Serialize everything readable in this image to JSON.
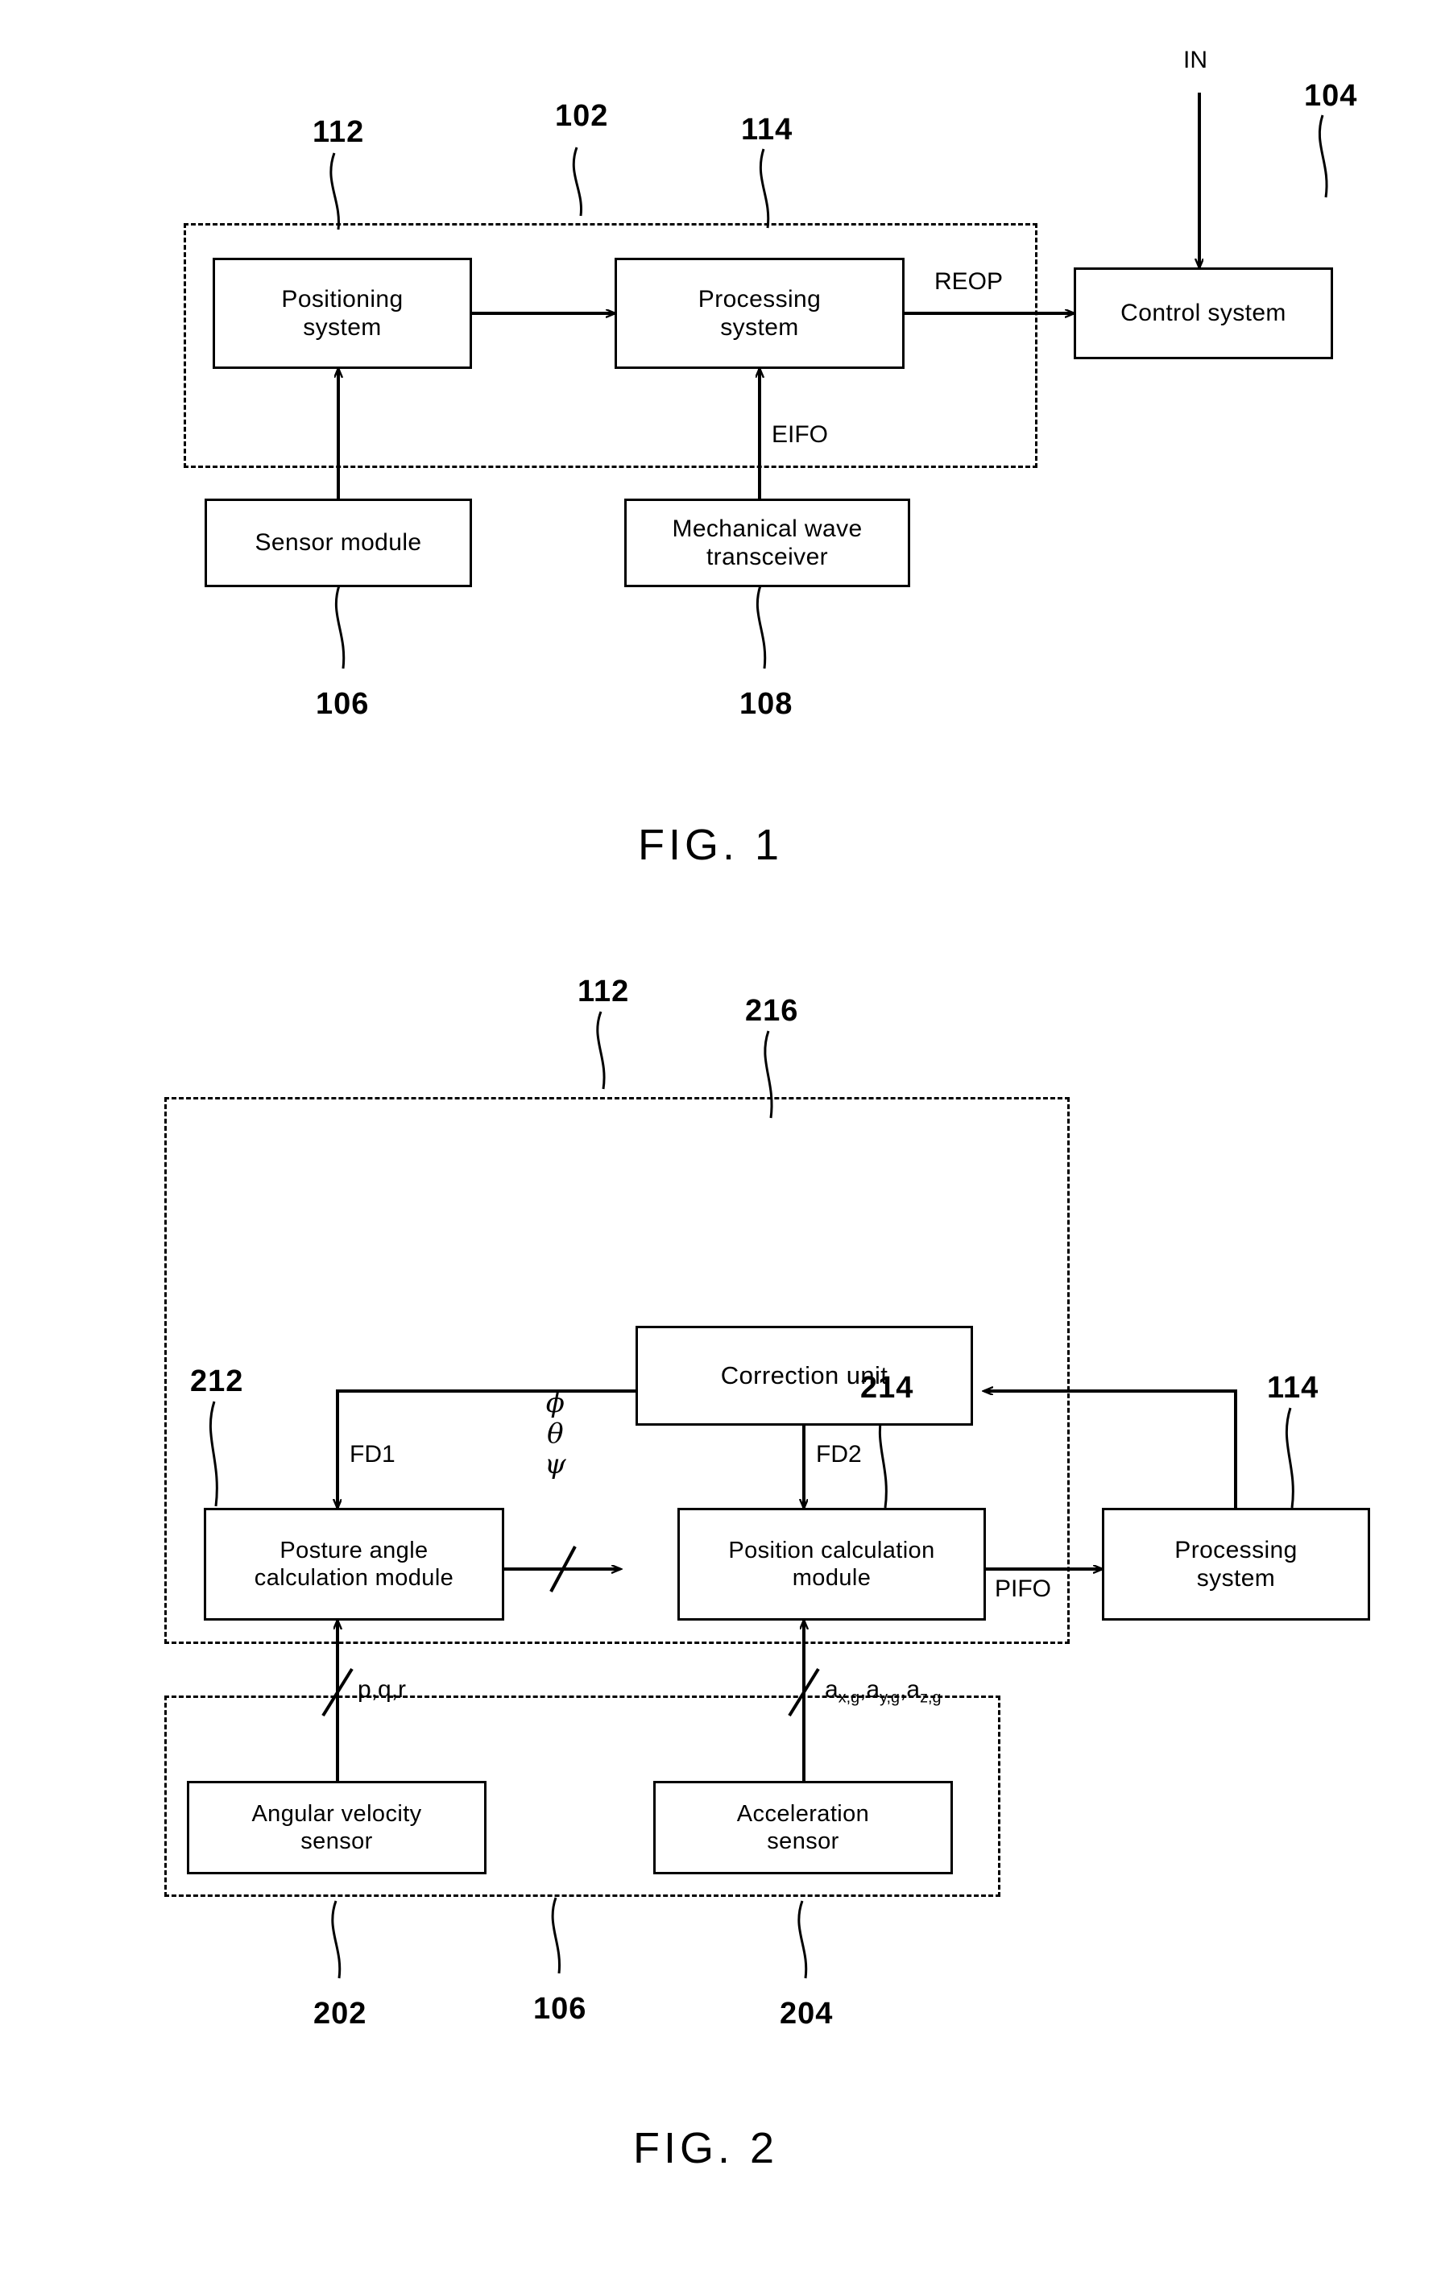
{
  "document": {
    "type": "patent-drawing-sheet",
    "ink_color": "#000000",
    "background_color": "#ffffff"
  },
  "figure1": {
    "caption": "FIG. 1",
    "dashed_group_ref": "102",
    "boxes": {
      "positioning_system": "Positioning\nsystem",
      "processing_system": "Processing\nsystem",
      "control_system": "Control system",
      "sensor_module": "Sensor module",
      "mechanical_wave_transceiver": "Mechanical wave\ntransceiver"
    },
    "signals": {
      "reop": "REOP",
      "eifo": "EIFO",
      "in": "IN"
    },
    "refs": {
      "positioning_system": "112",
      "group": "102",
      "processing_system": "114",
      "control_system": "104",
      "sensor_module": "106",
      "mechanical_wave_transceiver": "108"
    }
  },
  "figure2": {
    "caption": "FIG. 2",
    "dashed_group_ref": "112",
    "inner_group_ref": "106",
    "boxes": {
      "correction_unit": "Correction unit",
      "posture_angle_calculation_module": "Posture angle\ncalculation module",
      "position_calculation_module": "Position calculation\nmodule",
      "processing_system": "Processing\nsystem",
      "angular_velocity_sensor": "Angular velocity\nsensor",
      "acceleration_sensor": "Acceleration\nsensor"
    },
    "signals": {
      "fd1": "FD1",
      "fd2": "FD2",
      "pifo": "PIFO",
      "euler_angles": "ϕ\nθ\nψ",
      "angular_rates": "p,q,r",
      "accelerations_prefix": "a",
      "accelerations": "a x,g , a y,g , a z,g"
    },
    "refs": {
      "group": "112",
      "correction_unit": "216",
      "posture_angle_calculation_module": "212",
      "position_calculation_module": "214",
      "processing_system": "114",
      "angular_velocity_sensor": "202",
      "sensor_module_group": "106",
      "acceleration_sensor": "204"
    }
  }
}
